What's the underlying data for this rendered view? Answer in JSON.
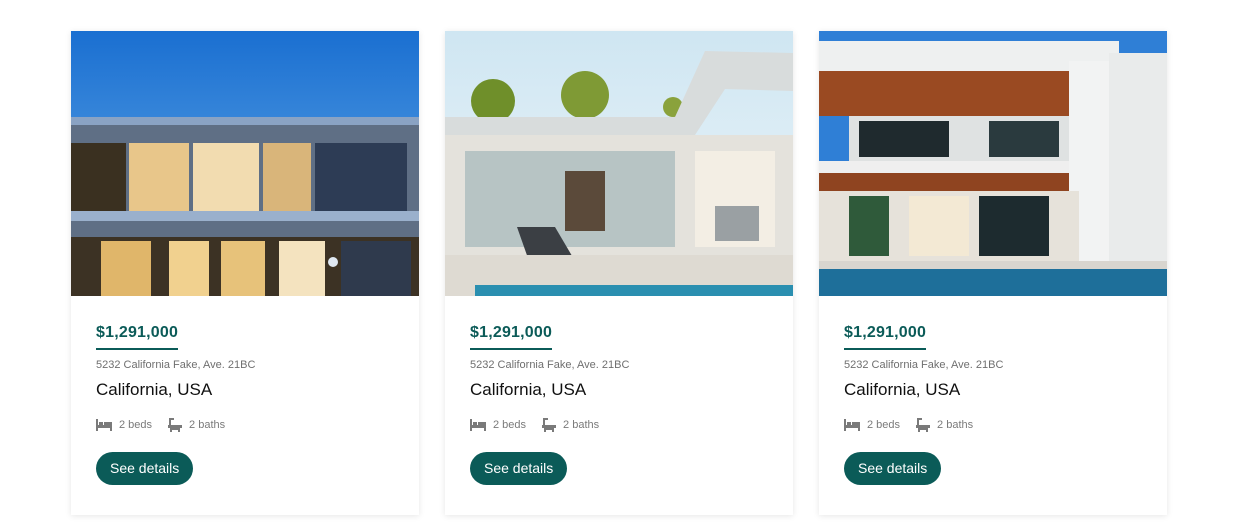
{
  "listings": [
    {
      "image": "modern-house-evening-photo",
      "price": "$1,291,000",
      "address": "5232 California Fake, Ave. 21BC",
      "location": "California, USA",
      "beds": "2 beds",
      "baths": "2 baths",
      "button": "See details"
    },
    {
      "image": "house-patio-pool-photo",
      "price": "$1,291,000",
      "address": "5232 California Fake, Ave. 21BC",
      "location": "California, USA",
      "beds": "2 beds",
      "baths": "2 baths",
      "button": "See details"
    },
    {
      "image": "white-villa-pool-photo",
      "price": "$1,291,000",
      "address": "5232 California Fake, Ave. 21BC",
      "location": "California, USA",
      "beds": "2 beds",
      "baths": "2 baths",
      "button": "See details"
    }
  ],
  "colors": {
    "accent": "#0b5b58",
    "text": "#111111",
    "muted": "#7a7a7a"
  },
  "icons": {
    "beds": "bed-icon",
    "baths": "bathtub-icon"
  }
}
